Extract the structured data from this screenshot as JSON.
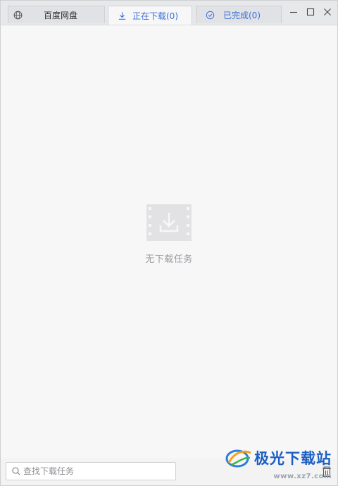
{
  "tabs": [
    {
      "label": "百度网盘",
      "icon": "globe-icon"
    },
    {
      "label": "正在下载(0)",
      "icon": "download-icon",
      "active": true
    },
    {
      "label": "已完成(0)",
      "icon": "check-circle-icon"
    }
  ],
  "window_controls": {
    "minimize_icon": "minimize-icon",
    "maximize_icon": "maximize-icon",
    "close_icon": "close-icon"
  },
  "empty_state": {
    "icon": "video-download-icon",
    "message": "无下载任务"
  },
  "search": {
    "placeholder": "查找下载任务",
    "value": ""
  },
  "watermark": {
    "brand": "极光下载站",
    "url": "www.xz7.com"
  },
  "colors": {
    "accent": "#3b6fd8",
    "background": "#f7f7f8",
    "muted_text": "#9a9b9e"
  }
}
